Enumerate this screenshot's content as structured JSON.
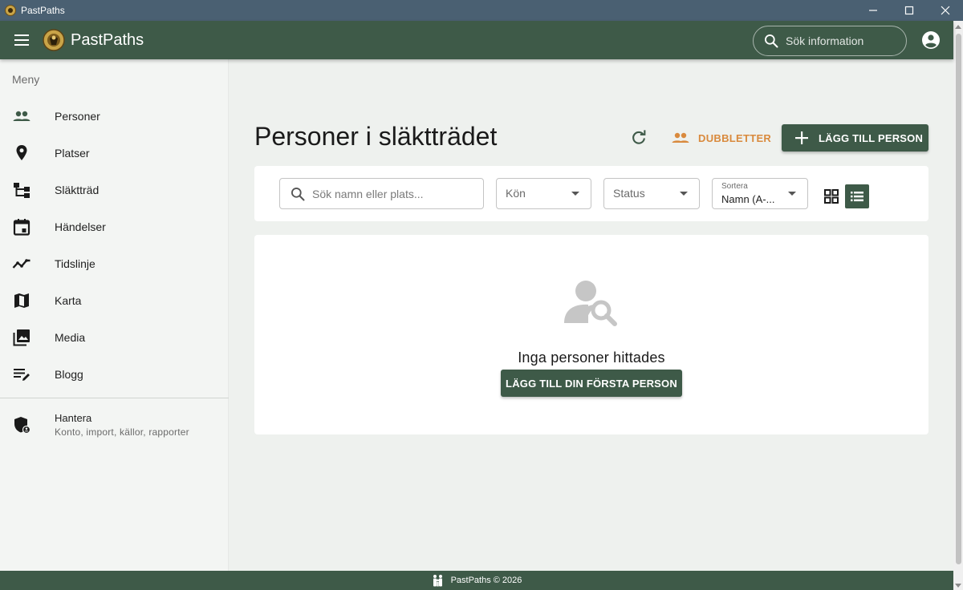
{
  "window": {
    "title": "PastPaths",
    "controls": [
      "minimize-icon",
      "maximize-icon",
      "close-icon"
    ]
  },
  "appbar": {
    "app_name": "PastPaths",
    "search_placeholder": "Sök information",
    "icons": [
      "menu-icon",
      "logo",
      "search-icon",
      "account-icon"
    ]
  },
  "sidebar": {
    "heading": "Meny",
    "items": [
      {
        "label": "Personer",
        "icon": "people-icon"
      },
      {
        "label": "Platser",
        "icon": "place-icon"
      },
      {
        "label": "Släktträd",
        "icon": "tree-icon"
      },
      {
        "label": "Händelser",
        "icon": "event-icon"
      },
      {
        "label": "Tidslinje",
        "icon": "timeline-icon"
      },
      {
        "label": "Karta",
        "icon": "map-icon"
      },
      {
        "label": "Media",
        "icon": "media-icon"
      },
      {
        "label": "Blogg",
        "icon": "blog-icon"
      }
    ],
    "manage": {
      "title": "Hantera",
      "subtitle": "Konto, import, källor, rapporter",
      "icon": "admin-shield-icon"
    }
  },
  "main": {
    "title": "Personer i släktträdet",
    "duplicates_label": "DUBBLETTER",
    "add_person_label": "LÄGG TILL PERSON",
    "filters": {
      "search_placeholder": "Sök namn eller plats...",
      "gender_label": "Kön",
      "status_label": "Status",
      "sort_label": "Sortera",
      "sort_value": "Namn (A-..."
    },
    "view_mode": "list",
    "empty_text": "Inga personer hittades",
    "first_person_label": "LÄGG TILL DIN FÖRSTA PERSON"
  },
  "footer": {
    "text": "PastPaths © 2026"
  },
  "colors": {
    "primary": "#3e5a48",
    "accent_orange": "#d98a3d",
    "titlebar": "#4a6072",
    "background": "#eef1ee"
  }
}
